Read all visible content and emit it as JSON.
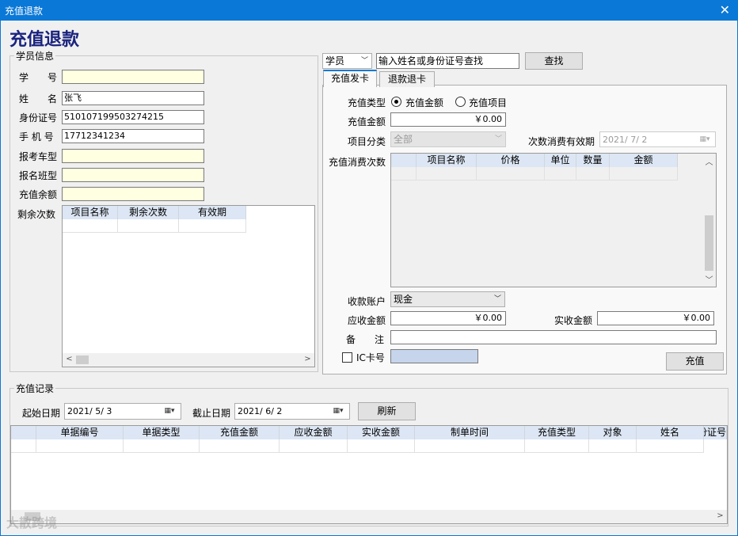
{
  "window": {
    "title": "充值退款",
    "close_icon": "✕"
  },
  "page_title": "充值退款",
  "student": {
    "legend": "学员信息",
    "labels": {
      "number": "学　　号",
      "name": "姓　　名",
      "id": "身份证号",
      "phone": "手 机 号",
      "car": "报考车型",
      "cls": "报名班型",
      "balance": "充值余额",
      "remaining": "剩余次数"
    },
    "values": {
      "number": "",
      "name": "张飞",
      "id": "510107199503274215",
      "phone": "17712341234",
      "car": "",
      "cls": "",
      "balance": ""
    },
    "remaining_columns": [
      "项目名称",
      "剩余次数",
      "有效期"
    ]
  },
  "search": {
    "type": "学员",
    "placeholder": "输入姓名或身份证号查找",
    "button": "查找"
  },
  "tabs": [
    "充值发卡",
    "退款退卡"
  ],
  "recharge": {
    "type_label": "充值类型",
    "option_amount": "充值金额",
    "option_project": "充值项目",
    "amount_label": "充值金额",
    "amount_value": "￥0.00",
    "category_label": "项目分类",
    "category_value": "全部",
    "expiry_label": "次数消费有效期",
    "expiry_value": "2021/ 7/ 2",
    "times_label": "充值消费次数",
    "times_columns": [
      "项目名称",
      "价格",
      "单位",
      "数量",
      "金额"
    ],
    "account_label": "收款账户",
    "account_value": "现金",
    "receivable_label": "应收金额",
    "receivable_value": "￥0.00",
    "received_label": "实收金额",
    "received_value": "￥0.00",
    "remark_label": "备　　注",
    "ic_label": "IC卡号",
    "submit": "充值"
  },
  "records": {
    "legend": "充值记录",
    "start_label": "起始日期",
    "start_value": "2021/ 5/ 3",
    "end_label": "截止日期",
    "end_value": "2021/ 6/ 2",
    "refresh": "刷新",
    "columns": [
      "单据编号",
      "单据类型",
      "充值金额",
      "应收金额",
      "实收金额",
      "制单时间",
      "充值类型",
      "对象",
      "姓名",
      "身份证号"
    ]
  },
  "watermark": "大散跨境",
  "accent_color": "#0a78d7"
}
